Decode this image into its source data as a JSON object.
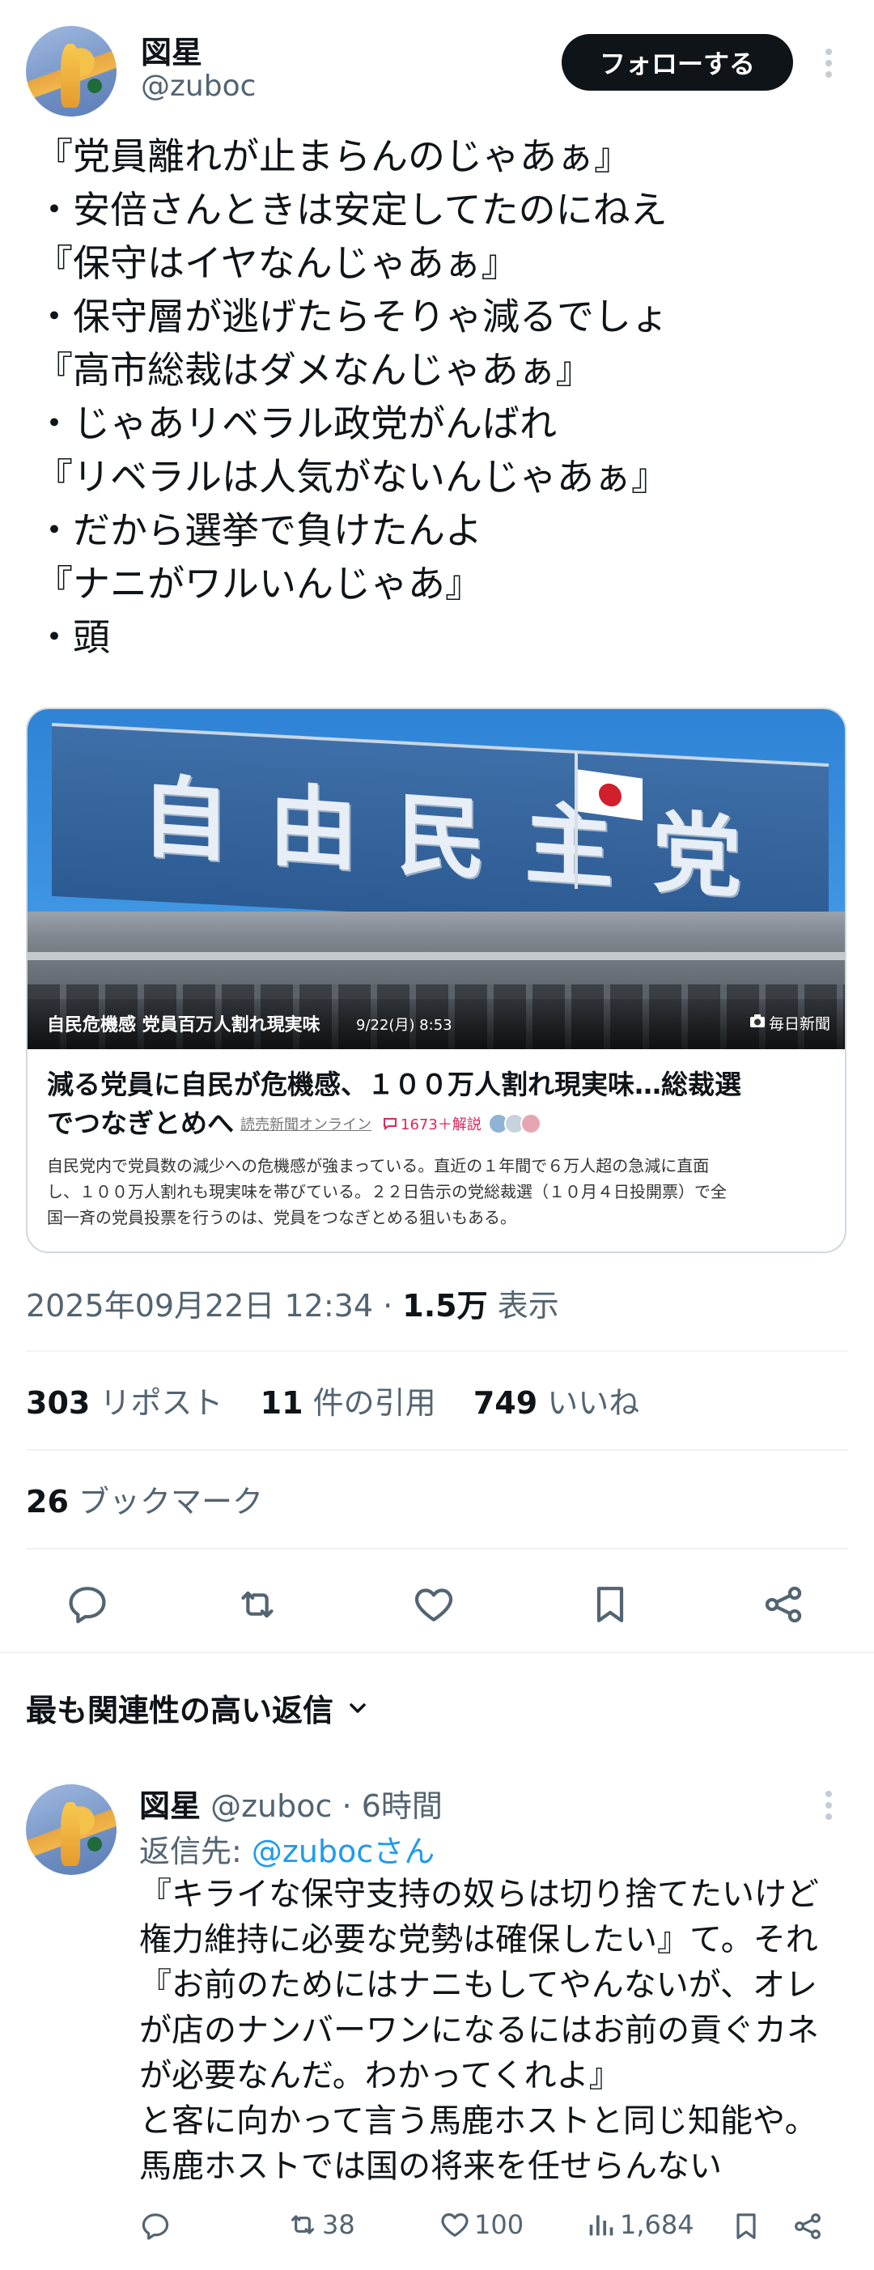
{
  "tweet": {
    "author_name": "図星",
    "author_handle": "@zuboc",
    "follow_label": "フォローする",
    "lines": [
      "『党員離れが止まらんのじゃあぁ』",
      "・安倍さんときは安定してたのにねえ",
      "『保守はイヤなんじゃあぁ』",
      "・保守層が逃げたらそりゃ減るでしょ",
      "『高市総裁はダメなんじゃあぁ』",
      "・じゃあリベラル政党がんばれ",
      "『リベラルは人気がないんじゃあぁ』",
      "・だから選挙で負けたんよ",
      "『ナニがワルいんじゃあ』",
      "・頭"
    ]
  },
  "card": {
    "image_sign": "自由民主党",
    "overlay_tag": "自民危機感 党員百万人割れ現実味",
    "overlay_date": "9/22(月) 8:53",
    "overlay_source": "毎日新聞",
    "headline_line1": "減る党員に自民が危機感、１００万人割れ現実味…総裁選",
    "headline_line2": "でつなぎとめへ",
    "publisher": "読売新聞オンライン",
    "comments": "1673＋解説",
    "summary_lines": [
      "自民党内で党員数の減少への危機感が強まっている。直近の１年間で６万人超の急減に直面",
      "し、１００万人割れも現実味を帯びている。２２日告示の党総裁選（１０月４日投開票）で全",
      "国一斉の党員投票を行うのは、党員をつなぎとめる狙いもある。"
    ]
  },
  "meta": {
    "datetime": "2025年09月22日 12:34",
    "sep": "·",
    "views_num": "1.5万",
    "views_label": "表示"
  },
  "stats": {
    "reposts_num": "303",
    "reposts_label": "リポスト",
    "quotes_num": "11",
    "quotes_label": "件の引用",
    "likes_num": "749",
    "likes_label": "いいね",
    "bookmarks_num": "26",
    "bookmarks_label": "ブックマーク"
  },
  "sort": {
    "label": "最も関連性の高い返信"
  },
  "reply": {
    "author_name": "図星",
    "author_handle": "@zuboc",
    "sep": "·",
    "time": "6時間",
    "replying_to_label": "返信先:",
    "replying_to_handle": "@zubocさん",
    "lines": [
      "『キライな保守支持の奴らは切り捨てたいけど",
      "権力維持に必要な党勢は確保したい』て。それ",
      "『お前のためにはナニもしてやんないが、オレ",
      "が店のナンバーワンになるにはお前の貢ぐカネ",
      "が必要なんだ。わかってくれよ』",
      "と客に向かって言う馬鹿ホストと同じ知能や。",
      "馬鹿ホストでは国の将来を任せらんない"
    ],
    "retweets": "38",
    "likes": "100",
    "views": "1,684"
  },
  "icons": {
    "more": "more-vertical-icon",
    "reply": "comment-icon",
    "retweet": "retweet-icon",
    "like": "heart-icon",
    "bookmark": "bookmark-icon",
    "share": "share-icon",
    "chevron": "chevron-down-icon",
    "camera": "camera-icon",
    "comment_badge": "comment-badge-icon",
    "views": "bar-chart-icon"
  },
  "colors": {
    "text": "#0f1419",
    "muted": "#536471",
    "link": "#1d9bf0",
    "follow_bg": "#0f1419",
    "border": "#cfd9de",
    "comment_red": "#e0245e"
  }
}
